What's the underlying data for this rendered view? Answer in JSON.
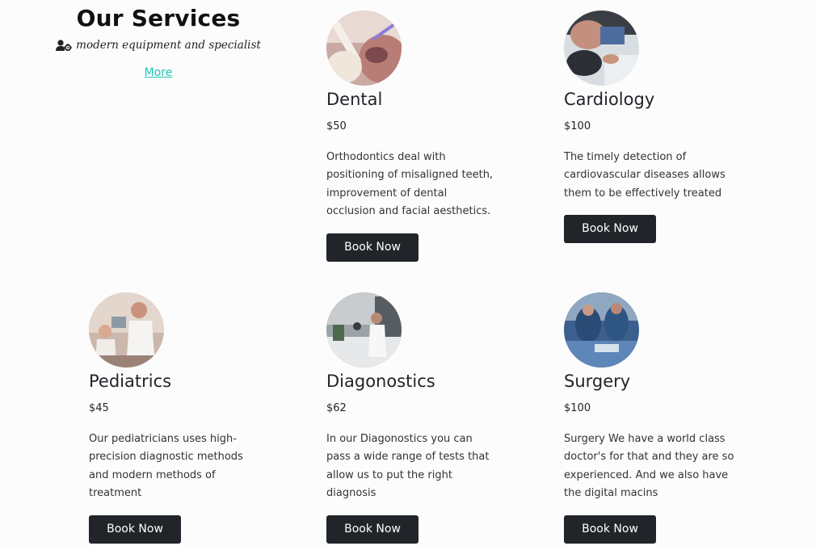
{
  "intro": {
    "title": "Our Services",
    "tagline": "modern equipment and specialist",
    "tagline_icon": "user-gear-icon",
    "more_label": "More",
    "link_color": "#20c6b6"
  },
  "services": [
    {
      "name": "Dental",
      "price": "$50",
      "description": "Orthodontics deal with positioning of misaligned teeth, improvement of dental occlusion and facial aesthetics.",
      "button": "Book Now",
      "image": "dental-photo"
    },
    {
      "name": "Cardiology",
      "price": "$100",
      "description": "The timely detection of cardiovascular diseases allows them to be effectively treated",
      "button": "Book Now",
      "image": "cardiology-photo"
    },
    {
      "name": "Pediatrics",
      "price": "$45",
      "description": "Our pediatricians uses high-precision diagnostic methods and modern methods of treatment",
      "button": "Book Now",
      "image": "pediatrics-photo"
    },
    {
      "name": "Diagonostics",
      "price": "$62",
      "description": "In our Diagonostics you can pass a wide range of tests that allow us to put the right diagnosis",
      "button": "Book Now",
      "image": "diagnostics-photo"
    },
    {
      "name": "Surgery",
      "price": "$100",
      "description": "Surgery We have a world class doctor's for that and they are so experienced. And we also have the digital macins",
      "button": "Book Now",
      "image": "surgery-photo"
    }
  ],
  "colors": {
    "button_bg": "#212529",
    "button_text": "#ffffff",
    "page_bg": "#fcfcfc"
  }
}
